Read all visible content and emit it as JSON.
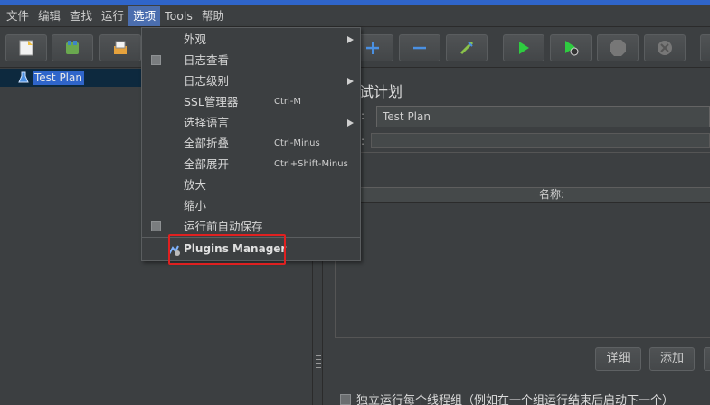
{
  "menubar": {
    "items": [
      "文件",
      "编辑",
      "查找",
      "运行",
      "选项",
      "Tools",
      "帮助"
    ],
    "active_index": 4
  },
  "tree": {
    "root_label": "Test Plan"
  },
  "panel": {
    "title_partial": "试计划",
    "name_value": "Test Plan",
    "param_header": "名称:"
  },
  "buttons": {
    "detail": "详细",
    "add": "添加"
  },
  "checkbox": {
    "label": "独立运行每个线程组（例如在一个组运行结束后启动下一个）"
  },
  "options_menu": {
    "items": [
      {
        "label": "外观",
        "shortcut": "",
        "submenu": true,
        "checkbox": false
      },
      {
        "label": "日志查看",
        "shortcut": "",
        "submenu": false,
        "checkbox": true
      },
      {
        "label": "日志级别",
        "shortcut": "",
        "submenu": true,
        "checkbox": false
      },
      {
        "label": "SSL管理器",
        "shortcut": "Ctrl-M",
        "submenu": false,
        "checkbox": false
      },
      {
        "label": "选择语言",
        "shortcut": "",
        "submenu": true,
        "checkbox": false
      },
      {
        "label": "全部折叠",
        "shortcut": "Ctrl-Minus",
        "submenu": false,
        "checkbox": false
      },
      {
        "label": "全部展开",
        "shortcut": "Ctrl+Shift-Minus",
        "submenu": false,
        "checkbox": false
      },
      {
        "label": "放大",
        "shortcut": "",
        "submenu": false,
        "checkbox": false
      },
      {
        "label": "缩小",
        "shortcut": "",
        "submenu": false,
        "checkbox": false
      },
      {
        "label": "运行前自动保存",
        "shortcut": "",
        "submenu": false,
        "checkbox": true
      }
    ],
    "plugins_manager": "Plugins Manager"
  },
  "colors": {
    "accent": "#2f65ca",
    "menu_active": "#4b6eaf",
    "highlight": "#e02020",
    "background": "#3c3f41"
  }
}
